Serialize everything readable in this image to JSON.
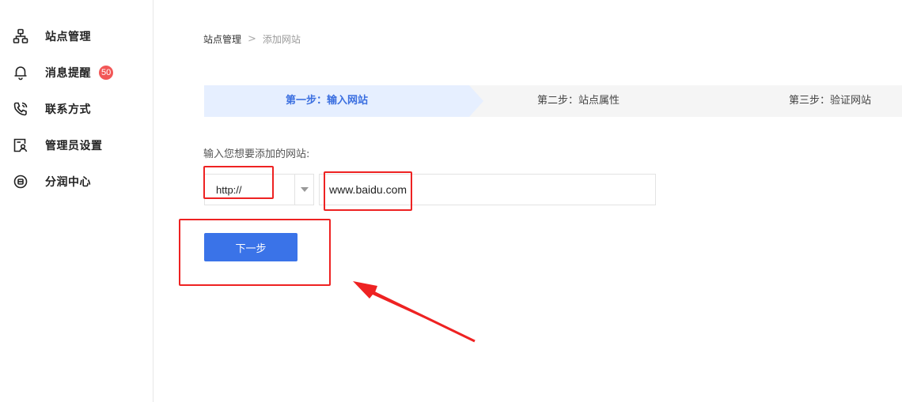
{
  "sidebar": {
    "items": [
      {
        "label": "站点管理",
        "icon": "sitemap-icon"
      },
      {
        "label": "消息提醒",
        "icon": "bell-icon",
        "badge": "50"
      },
      {
        "label": "联系方式",
        "icon": "phone-icon"
      },
      {
        "label": "管理员设置",
        "icon": "admin-user-icon"
      },
      {
        "label": "分润中心",
        "icon": "profit-share-icon"
      }
    ]
  },
  "breadcrumb": {
    "root": "站点管理",
    "separator": ">",
    "current": "添加网站"
  },
  "steps": [
    {
      "label": "第一步：输入网站",
      "active": true
    },
    {
      "label": "第二步：站点属性",
      "active": false
    },
    {
      "label": "第三步：验证网站",
      "active": false
    }
  ],
  "form": {
    "label": "输入您想要添加的网站:",
    "protocol": "http://",
    "url_value": "www.baidu.com"
  },
  "actions": {
    "next_label": "下一步"
  },
  "colors": {
    "accent": "#3a73e8",
    "active_step_bg": "#e6efff",
    "badge": "#f25757",
    "annotation": "#ee2222"
  }
}
